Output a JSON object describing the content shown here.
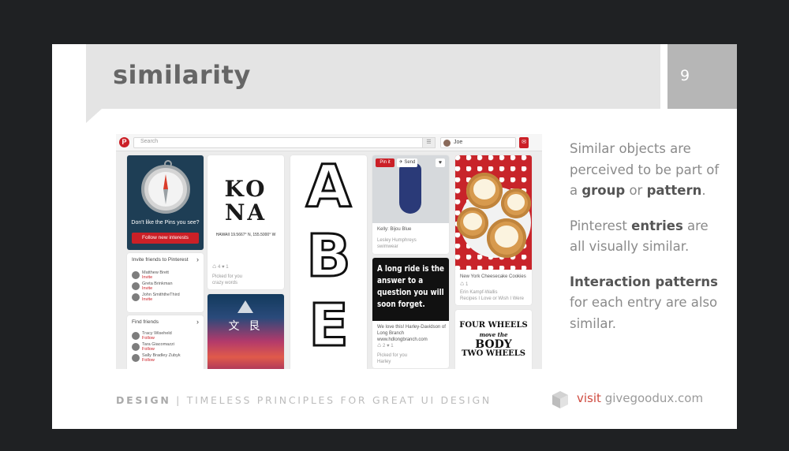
{
  "slide": {
    "title": "similarity",
    "page_number": "9"
  },
  "pinterest": {
    "search_placeholder": "Search",
    "user_name": "Joe",
    "compass_caption": "Don't like the Pins you see?",
    "follow_button": "Follow new interests",
    "invite_header": "Invite friends to Pinterest",
    "invite_friends": [
      {
        "name": "Matthew Brett",
        "action": "Invite"
      },
      {
        "name": "Greta Brinkman",
        "action": "Invite"
      },
      {
        "name": "John SmiththeThird",
        "action": "Invite"
      }
    ],
    "find_header": "Find friends",
    "find_friends": [
      {
        "name": "Tracy Wiseheld",
        "action": "Follow"
      },
      {
        "name": "Tara Giacomazzi",
        "action": "Follow"
      },
      {
        "name": "Sally Bradley Zubyk",
        "action": "Follow"
      }
    ],
    "kona_title_line1": "KO",
    "kona_title_line2": "NA",
    "kona_subtitle": "HAWAII 19.5667° N, 155.5000° W",
    "kona_meta": "♺ 4  ♥ 1",
    "kona_picked": "Picked for you",
    "kona_board": "crazy words",
    "abe_letters": [
      "A",
      "B",
      "E"
    ],
    "pin_it_label": "Pin it",
    "send_label": "✈ Send",
    "swim_caption": "Kelly: Bijou Blue",
    "swim_user": "Lesley Humphreys",
    "swim_board": "swimwear",
    "quote_text": "A long ride is the answer to a question you will soon forget.",
    "quote_desc": "We love this! Harley-Davidson of Long Branch www.hdlongbranch.com",
    "quote_meta": "♺ 2  ♥ 1",
    "quote_picked": "Picked for you",
    "quote_board": "Harley",
    "cookie_caption": "New York Cheesecake Cookies",
    "cookie_meta": "♺ 1",
    "cookie_user": "Erin Kampf-Wallis",
    "cookie_board": "Recipes I Love or Wish I Were",
    "wheels_lines": [
      "FOUR WHEELS",
      "move the",
      "BODY",
      "TWO WHEELS"
    ]
  },
  "text": {
    "p1_a": "Similar objects are perceived to be part of a ",
    "p1_b": "group",
    "p1_c": " or ",
    "p1_d": "pattern",
    "p1_e": ".",
    "p2_a": "Pinterest ",
    "p2_b": "entries",
    "p2_c": " are all visually similar.",
    "p3_a": "Interaction patterns",
    "p3_b": " for each entry are also similar."
  },
  "footer": {
    "design": "DESIGN",
    "subtitle": " | TIMELESS PRINCIPLES FOR GREAT UI DESIGN",
    "visit": "visit",
    "site": " givegoodux.com"
  },
  "colors": {
    "pinterest_red": "#cb2027",
    "visit_red": "#cf4a3f",
    "banner_gray": "#e4e4e4"
  }
}
